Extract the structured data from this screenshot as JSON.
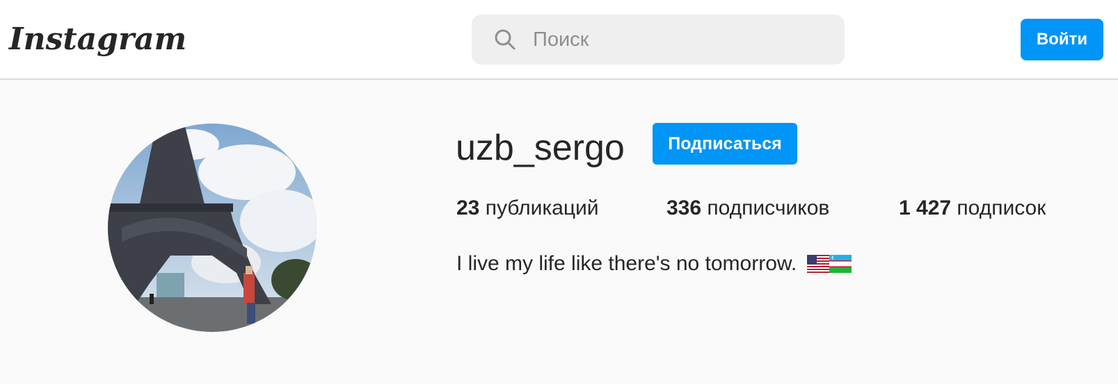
{
  "header": {
    "logo_text": "Instagram",
    "search": {
      "placeholder": "Поиск",
      "icon": "search-icon"
    },
    "login_label": "Войти"
  },
  "profile": {
    "username": "uzb_sergo",
    "follow_label": "Подписаться",
    "stats": [
      {
        "count": "23",
        "label": "публикаций"
      },
      {
        "count": "336",
        "label": "подписчиков"
      },
      {
        "count": "1 427",
        "label": "подписок"
      }
    ],
    "bio": "I live my life like there's no tomorrow.",
    "bio_flags": [
      "us-flag",
      "uz-flag"
    ]
  },
  "colors": {
    "accent": "#0095f6",
    "text": "#262626",
    "background": "#fafafa",
    "header_bg": "#ffffff",
    "search_bg": "#efefef",
    "placeholder": "#8e8e8e"
  }
}
